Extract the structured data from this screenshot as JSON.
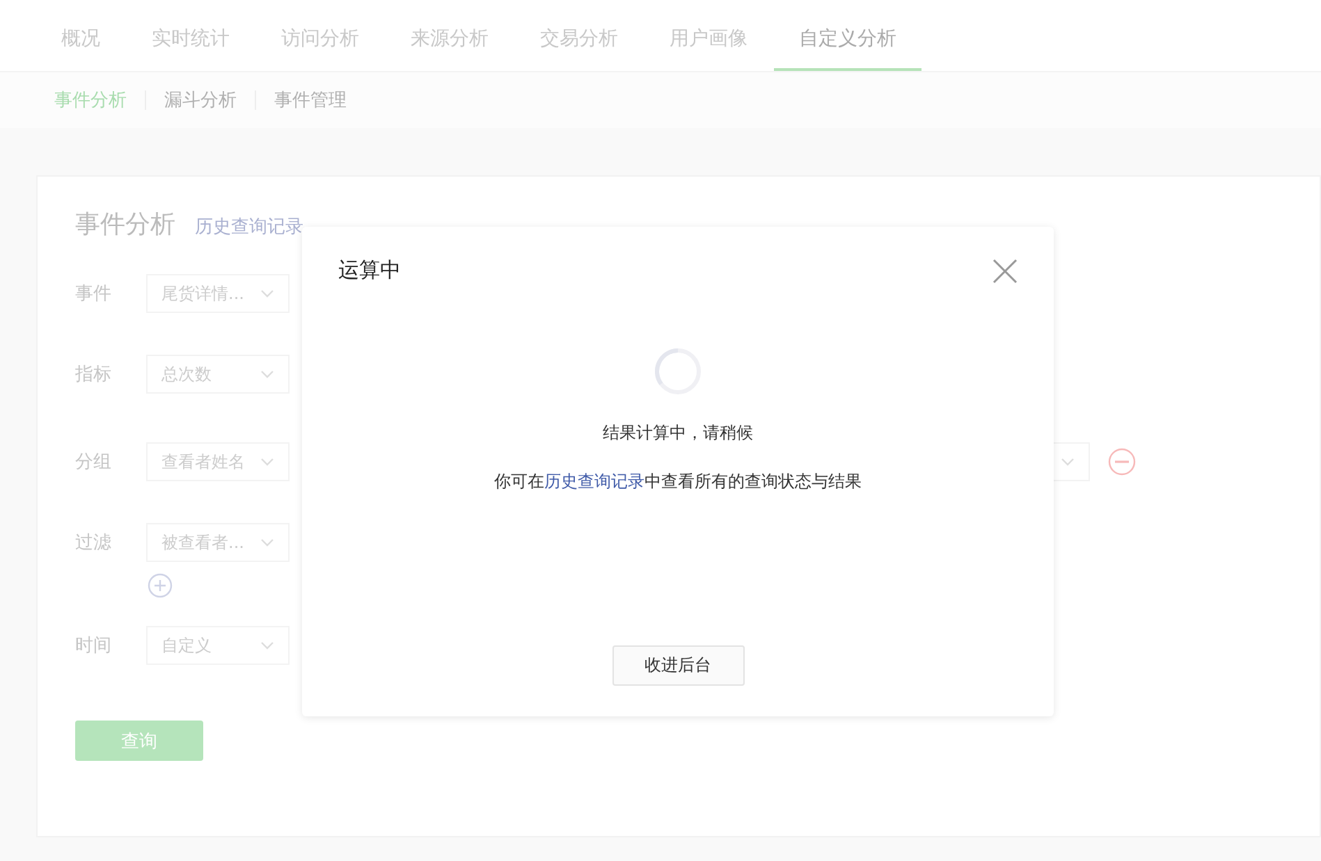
{
  "top_tabs": [
    {
      "label": "概况",
      "selected": false
    },
    {
      "label": "实时统计",
      "selected": false
    },
    {
      "label": "访问分析",
      "selected": false
    },
    {
      "label": "来源分析",
      "selected": false
    },
    {
      "label": "交易分析",
      "selected": false
    },
    {
      "label": "用户画像",
      "selected": false
    },
    {
      "label": "自定义分析",
      "selected": true
    }
  ],
  "sub_tabs": [
    {
      "label": "事件分析",
      "selected": true
    },
    {
      "label": "漏斗分析",
      "selected": false
    },
    {
      "label": "事件管理",
      "selected": false
    }
  ],
  "panel": {
    "title": "事件分析",
    "history_link": "历史查询记录",
    "rows": [
      {
        "kind": "plain",
        "label": "事件",
        "value": "尾货详情..."
      },
      {
        "kind": "plain",
        "label": "指标",
        "value": "总次数"
      },
      {
        "kind": "group",
        "label": "分组",
        "value": "查看者姓名"
      },
      {
        "kind": "filter",
        "label": "过滤",
        "value": "被查看者..."
      },
      {
        "kind": "plain",
        "label": "时间",
        "value": "自定义"
      }
    ],
    "query_button": "查询"
  },
  "dialog": {
    "title": "运算中",
    "message": "结果计算中，请稍候",
    "hint_before": "你可在",
    "hint_link": "历史查询记录",
    "hint_after": "中查看所有的查询状态与结果",
    "button": "收进后台"
  }
}
